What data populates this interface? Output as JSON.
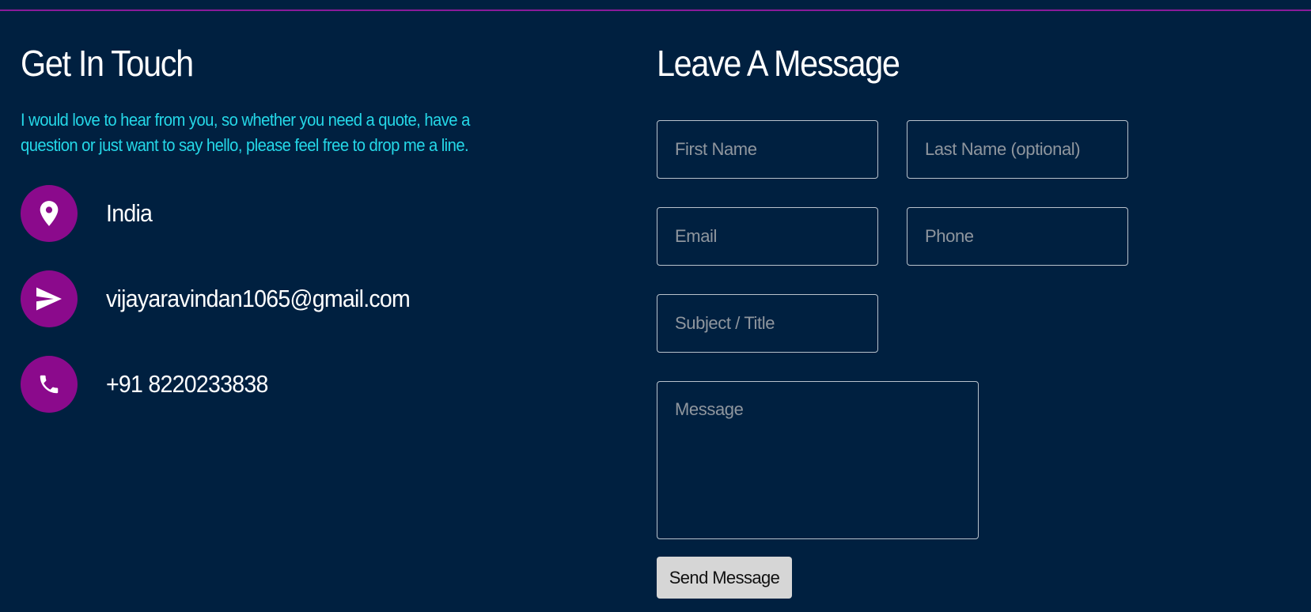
{
  "contact": {
    "heading": "Get In Touch",
    "intro": "I would love to hear from you, so whether you need a quote, have a question or just want to say hello, please feel free to drop me a line.",
    "location": {
      "icon": "location-pin-icon",
      "text": "India"
    },
    "email": {
      "icon": "send-icon",
      "text": "vijayaravindan1065@gmail.com"
    },
    "phone": {
      "icon": "phone-icon",
      "text": "+91 8220233838"
    }
  },
  "form": {
    "heading": "Leave A Message",
    "first_name": {
      "placeholder": "First Name",
      "value": ""
    },
    "last_name": {
      "placeholder": "Last Name (optional)",
      "value": ""
    },
    "email": {
      "placeholder": "Email",
      "value": ""
    },
    "phone": {
      "placeholder": "Phone",
      "value": ""
    },
    "subject": {
      "placeholder": "Subject / Title",
      "value": ""
    },
    "message": {
      "placeholder": "Message",
      "value": ""
    },
    "submit_label": "Send Message"
  },
  "colors": {
    "background": "#002040",
    "accent_rule": "#8a1a9a",
    "icon_circle": "#8b0a8c",
    "intro_text": "#25d8e8",
    "button_bg": "#d6d6d6"
  }
}
